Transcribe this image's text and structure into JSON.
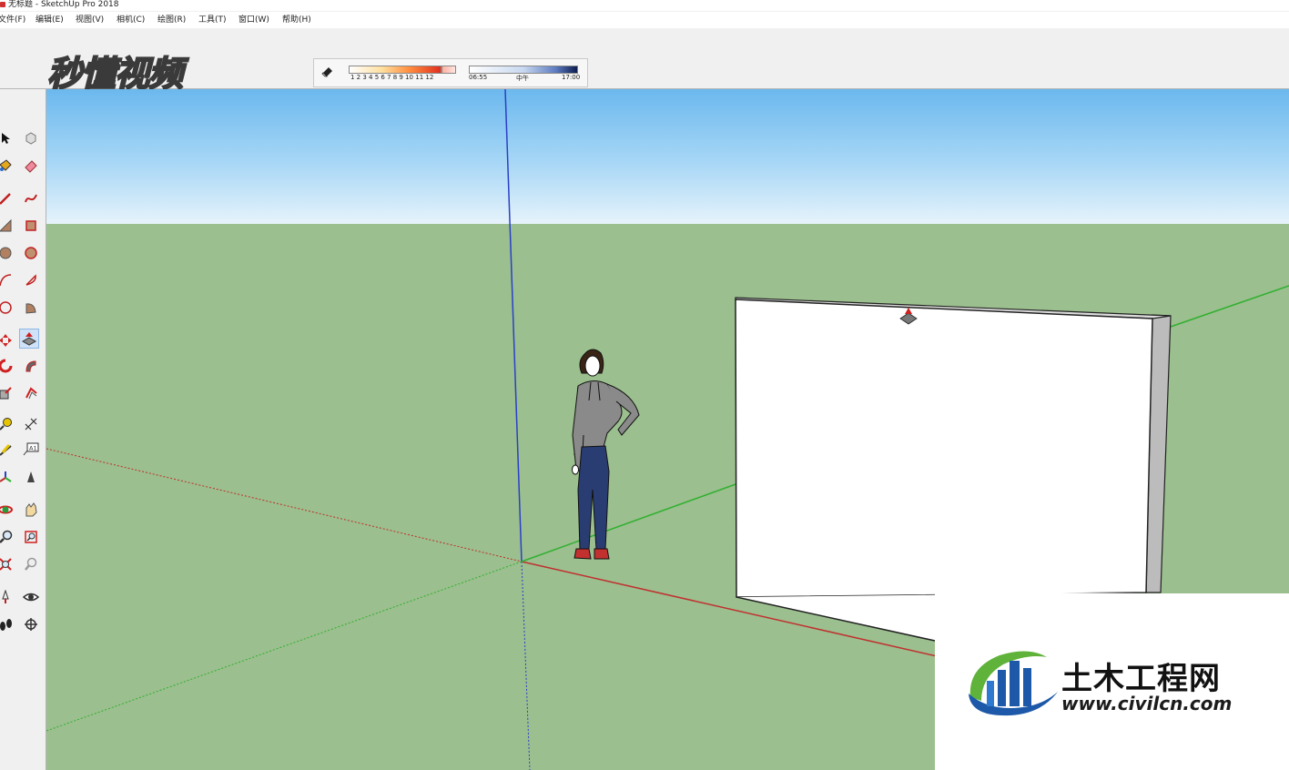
{
  "window": {
    "title": "无标题 - SketchUp Pro 2018"
  },
  "menu": [
    "文件(F)",
    "编辑(E)",
    "视图(V)",
    "相机(C)",
    "绘图(R)",
    "工具(T)",
    "窗口(W)",
    "帮助(H)"
  ],
  "shadow_panel": {
    "month_labels": "1 2 3 4 5 6 7 8 9 10 11 12",
    "time_start": "06:55",
    "time_mid": "中午",
    "time_end": "17:00"
  },
  "watermarks": {
    "top_left": "秒懂视频",
    "civil_title": "土木工程网",
    "civil_url": "www.civilcn.com"
  },
  "colors": {
    "sky_top": "#6bb8ee",
    "ground": "#9bbf8e",
    "axis_blue": "#2a40c8",
    "axis_red": "#c03030",
    "axis_green": "#30b030",
    "brand_blue": "#1d59a8",
    "brand_green": "#5fb23a"
  },
  "toolbar_icons": [
    "select-tool",
    "eraser-tool",
    "rotate-tool",
    "scale-tool",
    "tape-measure-tool",
    "text-tool",
    "paint-bucket-tool",
    "orbit-tool",
    "pan-tool",
    "zoom-tool",
    "zoom-extents-tool",
    "3d-warehouse",
    "extension-warehouse",
    "send-to-layout",
    "ruby-console"
  ],
  "left_toolbar_icons": [
    "select",
    "make-component",
    "paint-bucket",
    "eraser",
    "line",
    "freehand",
    "rectangle",
    "rotated-rectangle",
    "circle",
    "polygon",
    "arc",
    "pie",
    "two-point-arc",
    "three-point-arc",
    "move",
    "push-pull",
    "rotate",
    "follow-me",
    "scale",
    "offset",
    "tape-measure",
    "dimension",
    "protractor",
    "text",
    "axes",
    "3d-text",
    "orbit",
    "pan",
    "zoom",
    "zoom-window",
    "zoom-extents",
    "previous-view",
    "position-camera",
    "look-around",
    "walk",
    "section-plane"
  ],
  "selected_tool": "push-pull"
}
